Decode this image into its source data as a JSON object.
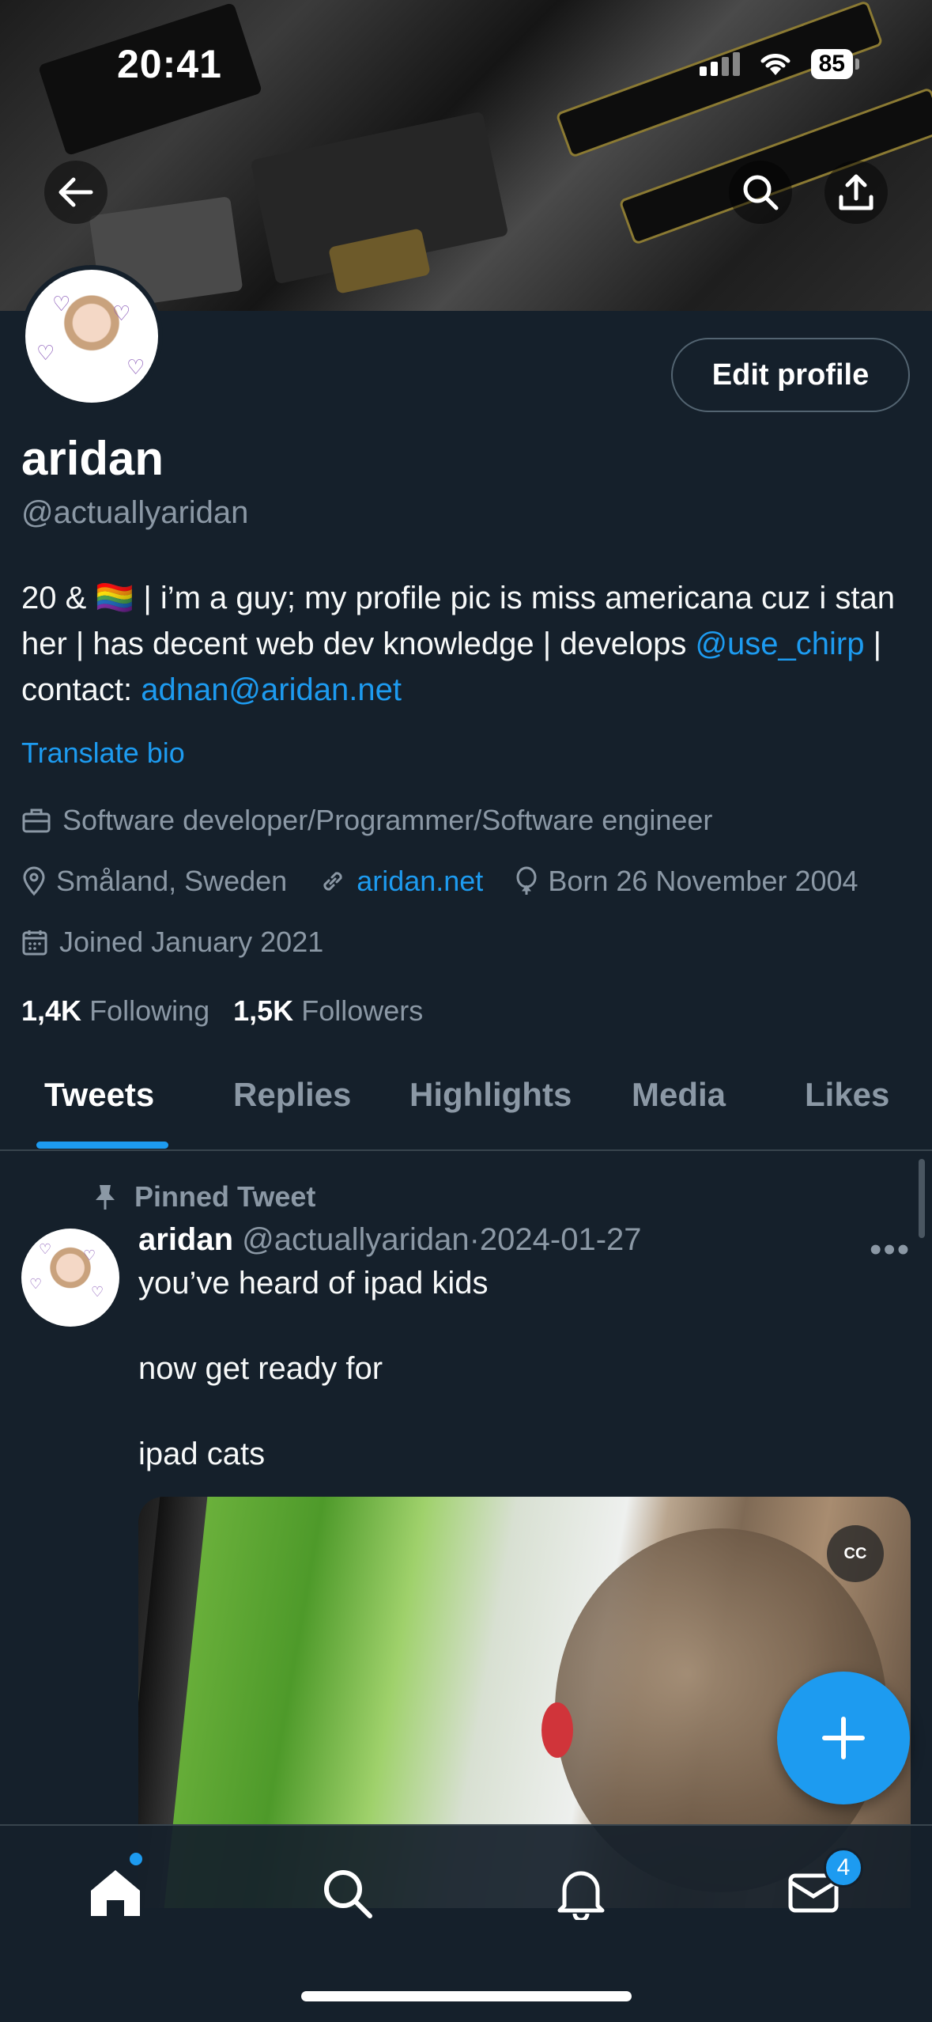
{
  "status_bar": {
    "time": "20:41",
    "battery": "85"
  },
  "profile": {
    "name": "aridan",
    "handle": "@actuallyaridan",
    "edit_label": "Edit profile",
    "bio": {
      "line_a": "20 & 🏳️‍🌈 | i’m a guy; my profile pic is miss americana cuz i stan her | has decent web dev knowledge | develops ",
      "mention": "@use_chirp",
      "line_b": " | contact: ",
      "email": "adnan@aridan.net"
    },
    "translate": "Translate bio",
    "profession": "Software developer/Programmer/Software engineer",
    "location": "Småland, Sweden",
    "website": "aridan.net",
    "born": "Born 26 November 2004",
    "joined": "Joined January 2021",
    "following_count": "1,4K",
    "following_label": "Following",
    "followers_count": "1,5K",
    "followers_label": "Followers"
  },
  "tabs": [
    "Tweets",
    "Replies",
    "Highlights",
    "Media",
    "Likes"
  ],
  "tweet": {
    "pinned_label": "Pinned Tweet",
    "author": "aridan",
    "handle": "@actuallyaridan",
    "separator": "·",
    "date": "2024-01-27",
    "lines": [
      "you’ve heard of ipad kids",
      "now get ready for",
      "ipad cats"
    ],
    "cc": "CC"
  },
  "nav": {
    "messages_badge": "4"
  },
  "colors": {
    "accent": "#1d9bf0",
    "background": "#15202b",
    "muted": "#8b98a5"
  },
  "icons": [
    "back-arrow-icon",
    "search-icon",
    "share-icon",
    "briefcase-icon",
    "location-pin-icon",
    "link-icon",
    "balloon-icon",
    "calendar-icon",
    "pin-icon",
    "more-icon",
    "compose-plus-icon",
    "home-icon",
    "search-nav-icon",
    "bell-icon",
    "mail-icon"
  ]
}
